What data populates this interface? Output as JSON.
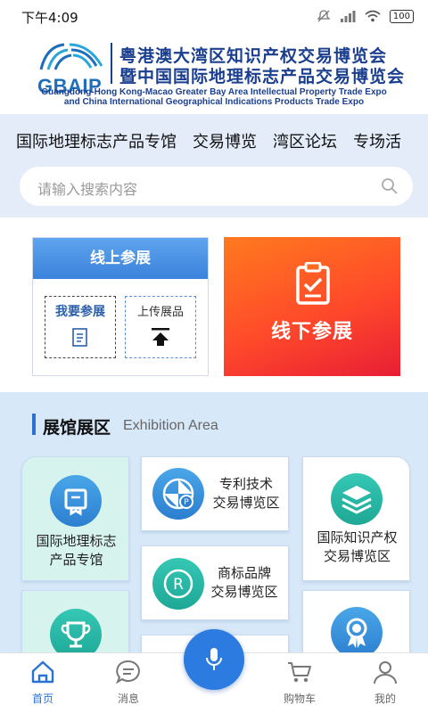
{
  "status_bar": {
    "time": "下午4:09",
    "battery": "100"
  },
  "banner": {
    "logo_text": "GBAIP",
    "title_line1": "粤港澳大湾区知识产权交易博览会",
    "title_line2": "暨中国国际地理标志产品交易博览会",
    "en_line1": "Guangdong-Hong Kong-Macao Greater Bay Area Intellectual Property Trade Expo",
    "en_line2": "and China International Geographical Indications Products Trade Expo"
  },
  "category_tabs": [
    "国际地理标志产品专馆",
    "交易博览",
    "湾区论坛",
    "专场活"
  ],
  "search": {
    "placeholder": "请输入搜索内容"
  },
  "participate": {
    "online_title": "线上参展",
    "join_label": "我要参展",
    "upload_label": "上传展品",
    "offline_label": "线下参展"
  },
  "exhibition": {
    "title": "展馆展区",
    "subtitle": "Exhibition  Area",
    "halls": {
      "gi_line1": "国际地理标志",
      "gi_line2": "产品专馆",
      "patent_line1": "专利技术",
      "patent_line2": "交易博览区",
      "ip_line1": "国际知识产权",
      "ip_line2": "交易博览区",
      "trademark_line1": "商标品牌",
      "trademark_line2": "交易博览区"
    }
  },
  "bottom_nav": [
    {
      "label": "首页",
      "active": true
    },
    {
      "label": "消息",
      "active": false
    },
    {
      "label": "购物车",
      "active": false
    },
    {
      "label": "我的",
      "active": false
    }
  ],
  "colors": {
    "accent": "#2b7be0",
    "brand_navy": "#1b3f8f",
    "offline_orange": "#ff5a24"
  }
}
